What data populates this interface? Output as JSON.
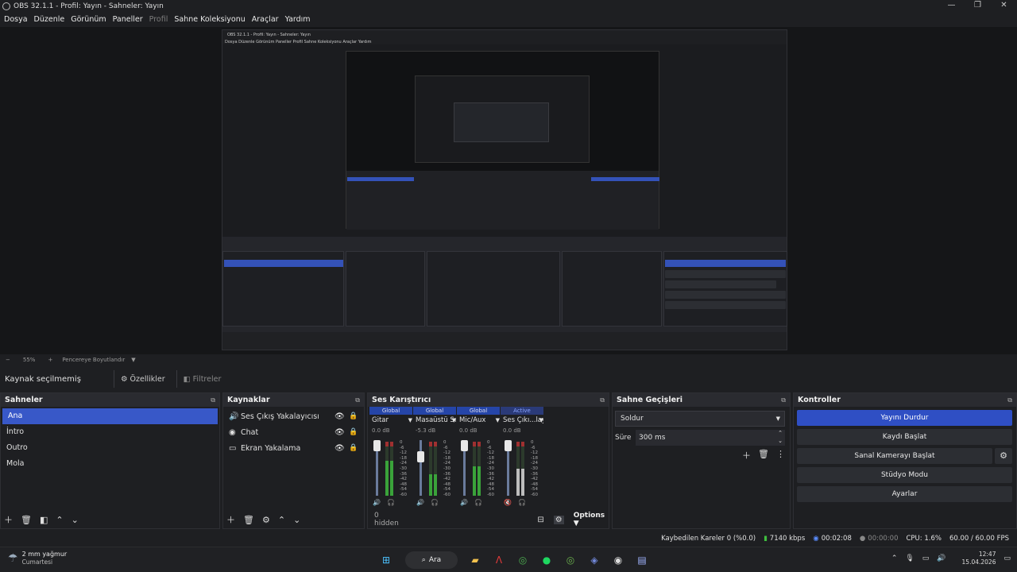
{
  "window": {
    "title": "OBS 32.1.1 - Profil: Yayın - Sahneler: Yayın",
    "controls": [
      "—",
      "❐",
      "✕"
    ]
  },
  "menu": {
    "file": "Dosya",
    "edit": "Düzenle",
    "view": "Görünüm",
    "docks": "Paneller",
    "profile": "Profil",
    "scene_collection": "Sahne Koleksiyonu",
    "tools": "Araçlar",
    "help": "Yardım"
  },
  "zoom": {
    "minus": "−",
    "value": "55%",
    "plus": "+",
    "fit": "Pencereye Boyutlandır"
  },
  "source_toolbar": {
    "none_selected": "Kaynak seçilmemiş",
    "properties": "Özellikler",
    "filters": "Filtreler"
  },
  "scenes": {
    "title": "Sahneler",
    "items": [
      "Ana",
      "İntro",
      "Outro",
      "Mola"
    ]
  },
  "sources": {
    "title": "Kaynaklar",
    "items": [
      {
        "label": "Ses Çıkış Yakalayıcısı",
        "icon": "speaker-icon"
      },
      {
        "label": "Chat",
        "icon": "globe-icon"
      },
      {
        "label": "Ekran Yakalama",
        "icon": "monitor-icon"
      }
    ]
  },
  "mixer": {
    "title": "Ses Karıştırıcı",
    "channels": [
      {
        "tag": "Global",
        "name": "Gitar",
        "db": "0.0 dB",
        "level": 0.65
      },
      {
        "tag": "Global",
        "name": "Masaüstü Ses",
        "db": "-5.3 dB",
        "level": 0.4
      },
      {
        "tag": "Global",
        "name": "Mic/Aux",
        "db": "0.0 dB",
        "level": 0.55
      },
      {
        "tag": "Active",
        "name": "Ses Çıkı...layıcısı",
        "db": "0.0 dB",
        "level": 0.5
      }
    ],
    "scale": [
      "0",
      "-6",
      "-12",
      "-18",
      "-24",
      "-30",
      "-36",
      "-42",
      "-48",
      "-54",
      "-60"
    ],
    "hidden": "0 hidden",
    "options": "Options"
  },
  "transitions": {
    "title": "Sahne Geçişleri",
    "selected": "Soldur",
    "duration_label": "Süre",
    "duration": "300 ms"
  },
  "controls": {
    "title": "Kontroller",
    "stop_stream": "Yayını Durdur",
    "start_record": "Kaydı Başlat",
    "virtual_cam": "Sanal Kamerayı Başlat",
    "studio_mode": "Stüdyo Modu",
    "settings": "Ayarlar"
  },
  "status": {
    "dropped": "Kaybedilen Kareler 0 (%0.0)",
    "bitrate": "7140 kbps",
    "stream_time": "00:02:08",
    "rec_time": "00:00:00",
    "cpu": "CPU: 1.6%",
    "fps": "60.00 / 60.00 FPS"
  },
  "taskbar": {
    "weather_temp": "2 mm yağmur",
    "weather_day": "Cumartesi",
    "search": "Ara",
    "time": "12:47",
    "date": "15.04.2026"
  },
  "nested": {
    "title": "OBS 32.1.1 - Profil: Yayın - Sahneler: Yayın",
    "menu": "Dosya   Düzenle   Görünüm   Paneller   Profil   Sahne Koleksiyonu   Araçlar   Yardım"
  },
  "colors": {
    "accent": "#3858c8",
    "panel": "#1e1f22",
    "header": "#2a2b30"
  }
}
